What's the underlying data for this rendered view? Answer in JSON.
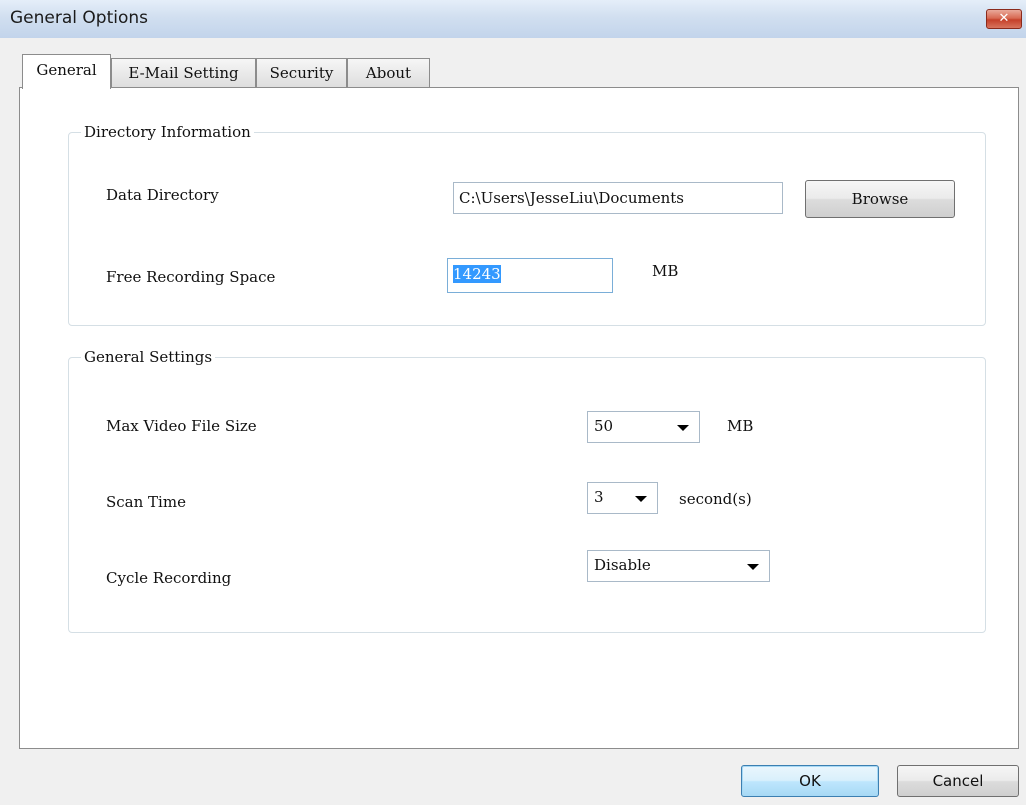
{
  "window": {
    "title": "General Options",
    "close_glyph": "✕"
  },
  "tabs": [
    {
      "label": "General",
      "active": true
    },
    {
      "label": "E-Mail Setting",
      "active": false
    },
    {
      "label": "Security",
      "active": false
    },
    {
      "label": "About",
      "active": false
    }
  ],
  "directory_info": {
    "title": "Directory Information",
    "data_directory": {
      "label": "Data Directory",
      "value": "C:\\Users\\JesseLiu\\Documents",
      "browse_label": "Browse"
    },
    "free_space": {
      "label": "Free Recording Space",
      "value": "14243",
      "unit": "MB"
    }
  },
  "general_settings": {
    "title": "General Settings",
    "max_video_size": {
      "label": "Max Video File Size",
      "value": "50",
      "unit": "MB"
    },
    "scan_time": {
      "label": "Scan Time",
      "value": "3",
      "unit": "second(s)"
    },
    "cycle_recording": {
      "label": "Cycle Recording",
      "value": "Disable"
    }
  },
  "buttons": {
    "ok": "OK",
    "cancel": "Cancel"
  }
}
